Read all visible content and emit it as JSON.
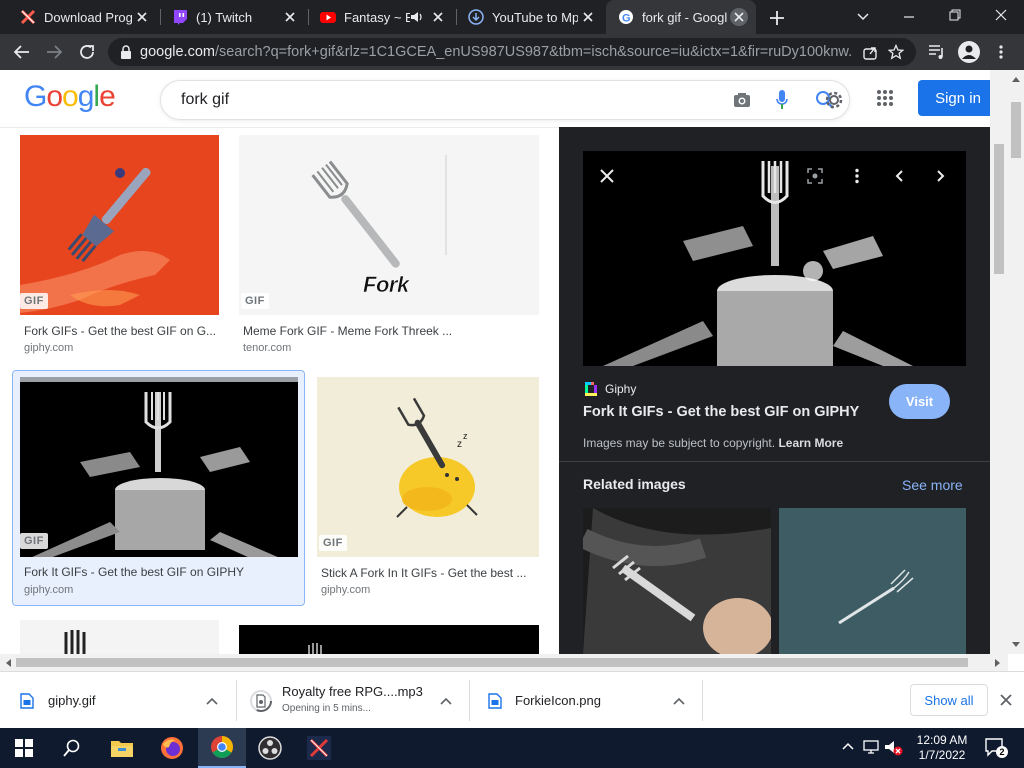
{
  "browser": {
    "tabs": [
      {
        "title": "Download Progr",
        "icon": "download-tab-icon"
      },
      {
        "title": "(1) Twitch",
        "icon": "twitch-icon"
      },
      {
        "title": "Fantasy ~ E",
        "icon": "youtube-icon",
        "audio": true
      },
      {
        "title": "YouTube to Mp",
        "icon": "converter-icon"
      },
      {
        "title": "fork gif - Googl",
        "icon": "google-icon",
        "active": true
      }
    ],
    "url_domain": "google.com",
    "url_rest": "/search?q=fork+gif&rlz=1C1GCEA_enUS987US987&tbm=isch&source=iu&ictx=1&fir=ruDy100knw..."
  },
  "google": {
    "logo": "Google",
    "query": "fork gif",
    "signin_label": "Sign in"
  },
  "results": [
    {
      "title": "Fork GIFs - Get the best GIF on G...",
      "source": "giphy.com",
      "badge": "GIF"
    },
    {
      "title": "Meme Fork GIF - Meme Fork Threek ...",
      "source": "tenor.com",
      "badge": "GIF",
      "caption": "Fork"
    },
    {
      "title": "Fork It GIFs - Get the best GIF on GIPHY",
      "source": "giphy.com",
      "badge": "GIF",
      "selected": true
    },
    {
      "title": "Stick A Fork In It GIFs - Get the best ...",
      "source": "giphy.com",
      "badge": "GIF"
    }
  ],
  "panel": {
    "source_name": "Giphy",
    "title": "Fork It GIFs - Get the best GIF on GIPHY",
    "visit_label": "Visit",
    "copyright": "Images may be subject to copyright.",
    "learn_more": "Learn More",
    "related_heading": "Related images",
    "see_more": "See more"
  },
  "downloads": [
    {
      "name": "giphy.gif",
      "status": ""
    },
    {
      "name": "Royalty free RPG....mp3",
      "status": "Opening in 5 mins..."
    },
    {
      "name": "ForkieIcon.png",
      "status": ""
    }
  ],
  "download_show_all": "Show all",
  "taskbar": {
    "time": "12:09 AM",
    "date": "1/7/2022",
    "notification_count": "2"
  },
  "colors": {
    "accent": "#1a73e8",
    "panel_bg": "#202124",
    "chrome_dark": "#202124",
    "taskbar": "#0f1a2e"
  }
}
